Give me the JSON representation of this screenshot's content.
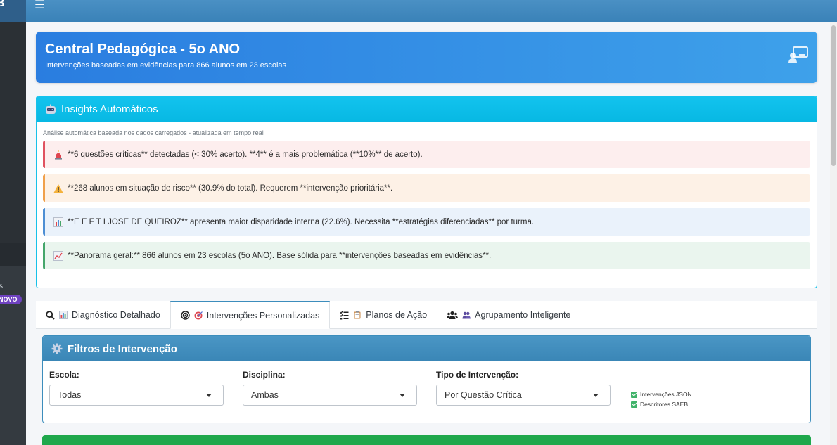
{
  "sidebar": {
    "brand_fragment": "B",
    "text_fragment": "s",
    "badge": "NOVO"
  },
  "hero": {
    "title": "Central Pedagógica - 5o ANO",
    "subtitle": "Intervenções baseadas em evidências para 866 alunos em 23 escolas",
    "icon": "chalkboard-teacher-icon"
  },
  "insights": {
    "title": "Insights Automáticos",
    "icon": "robot-icon",
    "subtitle": "Análise automática baseada nos dados carregados - atualizada em tempo real",
    "items": [
      {
        "icon": "siren-icon",
        "text": "**6 questões críticas** detectadas (< 30% acerto). **4** é a mais problemática (**10%** de acerto)."
      },
      {
        "icon": "warning-icon",
        "text": "**268 alunos em situação de risco** (30.9% do total). Requerem **intervenção prioritária**."
      },
      {
        "icon": "bar-chart-icon",
        "text": "**E E F T I JOSE DE QUEIROZ** apresenta maior disparidade interna (22.6%). Necessita **estratégias diferenciadas** por turma."
      },
      {
        "icon": "trend-chart-icon",
        "text": "**Panorama geral:** 866 alunos em 23 escolas (5o ANO). Base sólida para **intervenções baseadas em evidências**."
      }
    ]
  },
  "tabs": [
    {
      "label": "Diagnóstico Detalhado",
      "active": false
    },
    {
      "label": "Intervenções Personalizadas",
      "active": true
    },
    {
      "label": "Planos de Ação",
      "active": false
    },
    {
      "label": "Agrupamento Inteligente",
      "active": false
    }
  ],
  "filters": {
    "title": "Filtros de Intervenção",
    "escola": {
      "label": "Escola:",
      "value": "Todas"
    },
    "disciplina": {
      "label": "Disciplina:",
      "value": "Ambas"
    },
    "tipo": {
      "label": "Tipo de Intervenção:",
      "value": "Por Questão Crítica"
    },
    "checks": [
      "Intervenções JSON",
      "Descritores SAEB"
    ]
  },
  "colors": {
    "primary": "#3c8dbc",
    "info": "#0cc0ec",
    "success": "#1fa84c",
    "hero_start": "#2a7de0",
    "hero_end": "#3ea1ea"
  }
}
